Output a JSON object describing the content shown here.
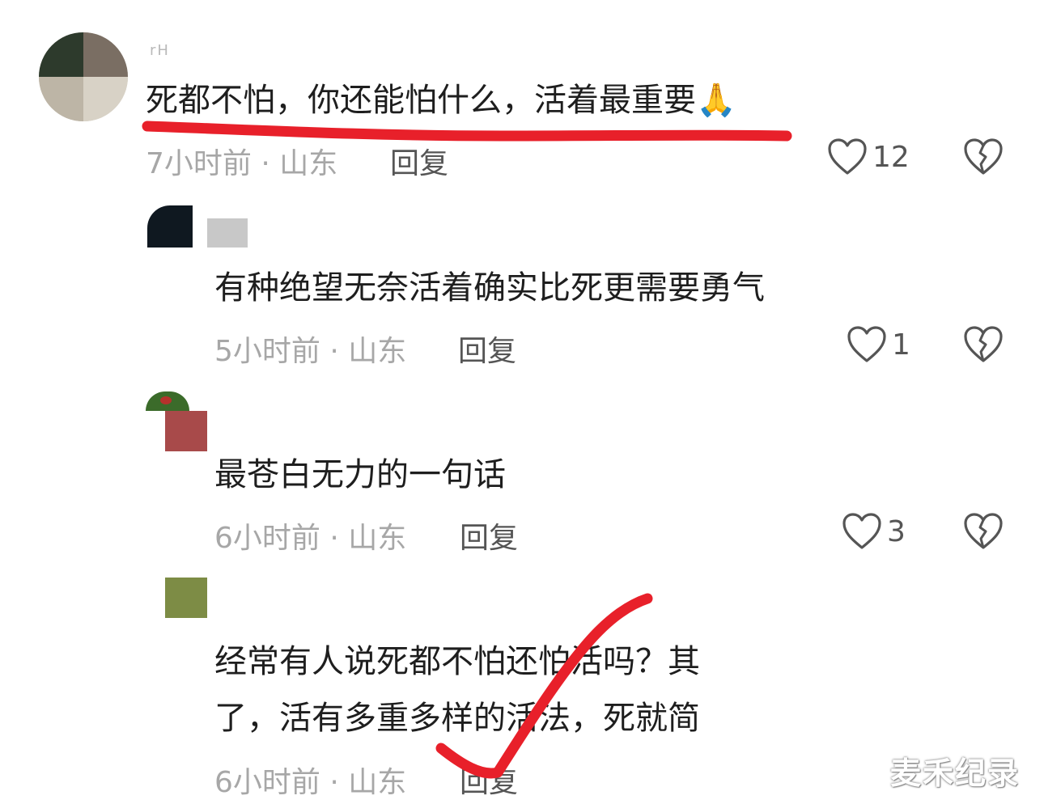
{
  "comments": [
    {
      "username": "rH",
      "text": "死都不怕，你还能怕什么，活着最重要",
      "emoji": "🙏",
      "time": "7小时前 · 山东",
      "reply_label": "回复",
      "like_count": "12"
    },
    {
      "username": "",
      "text": "有种绝望无奈活着确实比死更需要勇气",
      "time": "5小时前 · 山东",
      "reply_label": "回复",
      "like_count": "1"
    },
    {
      "username": "",
      "text": "最苍白无力的一句话",
      "time": "6小时前 · 山东",
      "reply_label": "回复",
      "like_count": "3"
    },
    {
      "username": "",
      "text_line1": "经常有人说死都不怕还怕活吗？其",
      "text_line2": "了，活有多重多样的活法，死就简",
      "time": "6小时前 · 山东",
      "reply_label": "回复"
    }
  ],
  "watermark": "麦禾纪录",
  "colors": {
    "annotation_red": "#e8202a",
    "meta_gray": "#a7a7a7",
    "icon_gray": "#555555"
  },
  "icons": {
    "like": "heart-outline-icon",
    "dislike": "broken-heart-icon"
  }
}
